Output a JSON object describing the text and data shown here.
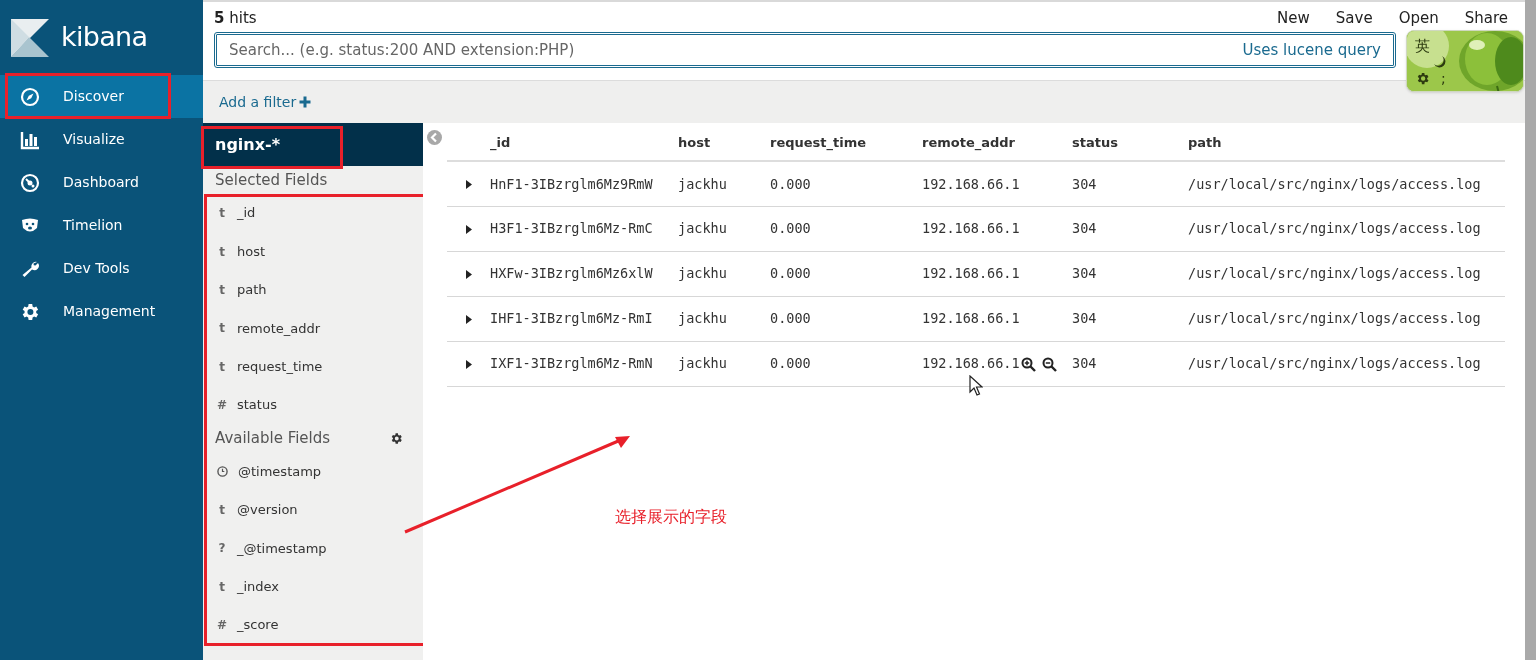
{
  "app": {
    "logo_text": "kibana"
  },
  "nav": [
    {
      "label": "Discover",
      "selected": true,
      "annotated": true
    },
    {
      "label": "Visualize",
      "selected": false,
      "annotated": false
    },
    {
      "label": "Dashboard",
      "selected": false,
      "annotated": false
    },
    {
      "label": "Timelion",
      "selected": false,
      "annotated": false
    },
    {
      "label": "Dev Tools",
      "selected": false,
      "annotated": false
    },
    {
      "label": "Management",
      "selected": false,
      "annotated": false
    }
  ],
  "top_bar": {
    "hits_count": "5",
    "hits_label": "hits",
    "actions": [
      "New",
      "Save",
      "Open",
      "Share"
    ]
  },
  "search": {
    "placeholder": "Search... (e.g. status:200 AND extension:PHP)",
    "syntax_link": "Uses lucene query"
  },
  "filter_bar": {
    "add_filter": "Add a filter"
  },
  "index_pattern": {
    "name": "nginx-*",
    "annotated": true
  },
  "fields_annotated": true,
  "selected_fields": {
    "title": "Selected Fields",
    "fields": [
      {
        "kind": "glyph",
        "glyph": "t",
        "name": "_id"
      },
      {
        "kind": "glyph",
        "glyph": "t",
        "name": "host"
      },
      {
        "kind": "glyph",
        "glyph": "t",
        "name": "path"
      },
      {
        "kind": "glyph",
        "glyph": "t",
        "name": "remote_addr"
      },
      {
        "kind": "glyph",
        "glyph": "t",
        "name": "request_time"
      },
      {
        "kind": "glyph",
        "glyph": "#",
        "name": "status"
      }
    ]
  },
  "available_fields": {
    "title": "Available Fields",
    "fields": [
      {
        "kind": "clock",
        "name": "@timestamp"
      },
      {
        "kind": "glyph",
        "glyph": "t",
        "name": "@version"
      },
      {
        "kind": "glyph",
        "glyph": "?",
        "name": "_@timestamp"
      },
      {
        "kind": "glyph",
        "glyph": "t",
        "name": "_index"
      },
      {
        "kind": "glyph",
        "glyph": "#",
        "name": "_score"
      }
    ]
  },
  "table": {
    "columns": [
      "_id",
      "host",
      "request_time",
      "remote_addr",
      "status",
      "path"
    ],
    "rows": [
      {
        "cells": [
          "HnF1-3IBzrglm6Mz9RmW",
          "jackhu",
          "0.000",
          "192.168.66.1",
          "304",
          "/usr/local/src/nginx/logs/access.log"
        ],
        "hovered": false
      },
      {
        "cells": [
          "H3F1-3IBzrglm6Mz-RmC",
          "jackhu",
          "0.000",
          "192.168.66.1",
          "304",
          "/usr/local/src/nginx/logs/access.log"
        ],
        "hovered": false
      },
      {
        "cells": [
          "HXFw-3IBzrglm6Mz6xlW",
          "jackhu",
          "0.000",
          "192.168.66.1",
          "304",
          "/usr/local/src/nginx/logs/access.log"
        ],
        "hovered": false
      },
      {
        "cells": [
          "IHF1-3IBzrglm6Mz-RmI",
          "jackhu",
          "0.000",
          "192.168.66.1",
          "304",
          "/usr/local/src/nginx/logs/access.log"
        ],
        "hovered": false
      },
      {
        "cells": [
          "IXF1-3IBzrglm6Mz-RmN",
          "jackhu",
          "0.000",
          "192.168.66.1",
          "304",
          "/usr/local/src/nginx/logs/access.log"
        ],
        "hovered": true
      }
    ]
  },
  "annotation": {
    "note": "选择展示的字段"
  },
  "ime": {
    "mode": "英",
    "punct": ";"
  }
}
